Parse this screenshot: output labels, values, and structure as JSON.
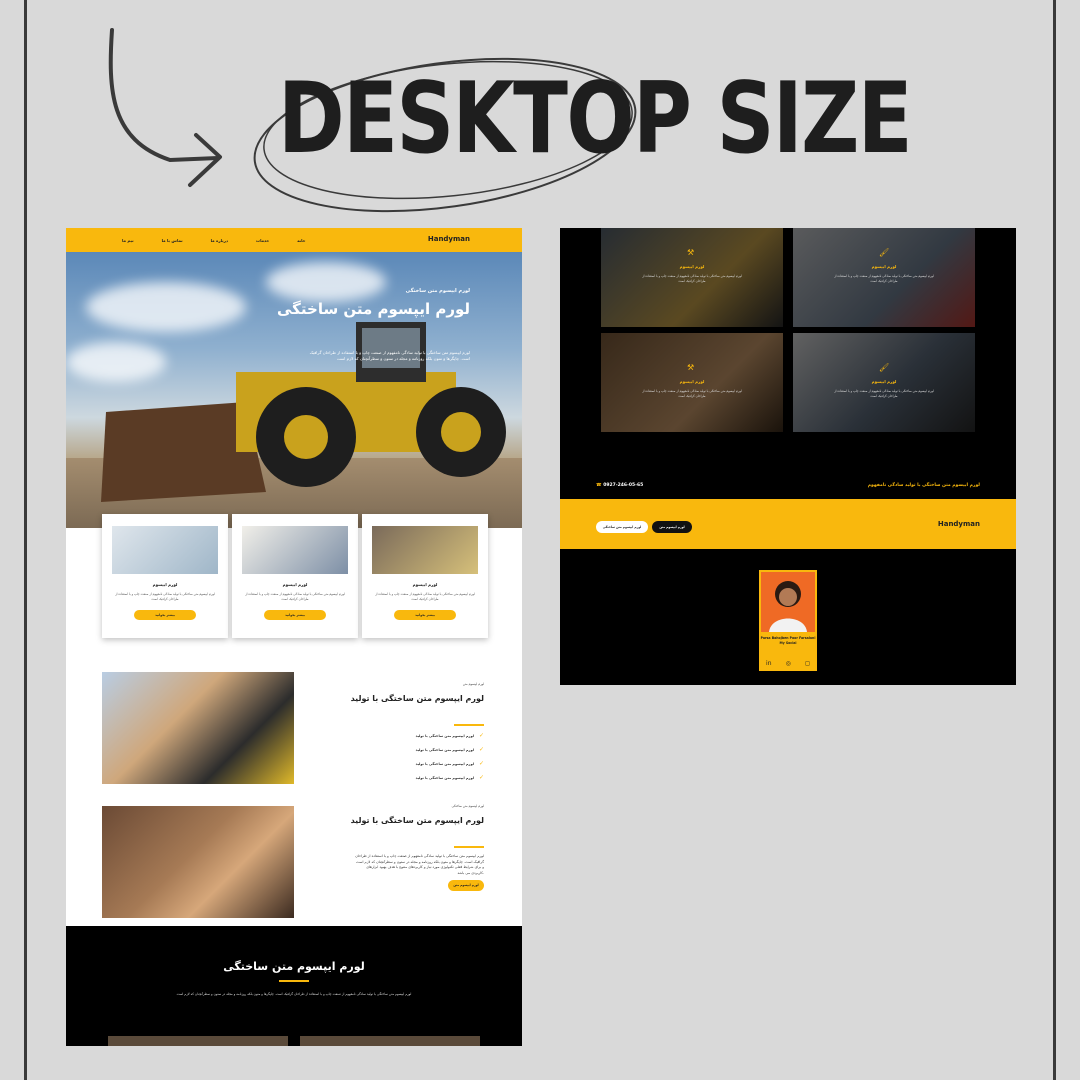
{
  "heading": "DESKTOP SIZE",
  "colors": {
    "accent": "#f9b80d",
    "dark": "#000000",
    "background": "#d9d9d9"
  },
  "left": {
    "logo": "Handyman",
    "nav": [
      "خانه",
      "خدمات",
      "درباره ما",
      "تماس با ما",
      "تیم ما"
    ],
    "hero": {
      "subtitle": "لورم ایپسوم متن ساختگی",
      "title": "لورم ایپسوم متن ساختگی",
      "description": "لورم ایپسوم متن ساختگی با تولید سادگی نامفهوم از صنعت چاپ و با استفاده از طراحان گرافیک است. چاپگرها و متون بلکه روزنامه و مجله در ستون و سطرآنچنان که لازم است"
    },
    "cards": [
      {
        "title": "لورم ایپسوم",
        "desc": "لورم ایپسوم متن ساختگی با تولید سادگی نامفهوم از صنعت چاپ و با استفاده از طراحان گرافیک است",
        "button": "بیشتر بخوانید"
      },
      {
        "title": "لورم ایپسوم",
        "desc": "لورم ایپسوم متن ساختگی با تولید سادگی نامفهوم از صنعت چاپ و با استفاده از طراحان گرافیک است",
        "button": "بیشتر بخوانید"
      },
      {
        "title": "لورم ایپسوم",
        "desc": "لورم ایپسوم متن ساختگی با تولید سادگی نامفهوم از صنعت چاپ و با استفاده از طراحان گرافیک است",
        "button": "بیشتر بخوانید"
      }
    ],
    "section1": {
      "kicker": "لورم ایپسوم متن",
      "title": "لورم ایپسوم متن ساختگی با تولید",
      "checks": [
        "لورم ایپسوم متن ساختگی با تولید",
        "لورم ایپسوم متن ساختگی با تولید",
        "لورم ایپسوم متن ساختگی با تولید",
        "لورم ایپسوم متن ساختگی با تولید"
      ]
    },
    "section2": {
      "kicker": "لورم ایپسوم متن ساختگی",
      "title": "لورم ایپسوم متن ساختگی با تولید",
      "description": "لورم ایپسوم متن ساختگی با تولید سادگی نامفهوم از صنعت چاپ و با استفاده از طراحان گرافیک است. چاپگرها و متون بلکه روزنامه و مجله در ستون و سطرآنچنان که لازم است و برای شرایط فعلی تکنولوژی مورد نیاز و کاربردهای متنوع با هدف بهبود ابزارهای کاربردی می باشد.",
      "button": "لورم ایپسوم متن"
    },
    "black": {
      "title": "لورم ایپسوم متن ساختگی",
      "description": "لورم ایپسوم متن ساختگی با تولید سادگی نامفهوم از صنعت چاپ و با استفاده از طراحان گرافیک است. چاپگرها و متون بلکه روزنامه و مجله در ستون و سطرآنچنان که لازم است"
    }
  },
  "right": {
    "tiles": [
      {
        "title": "لورم ایپسوم",
        "desc": "لورم ایپسوم متن ساختگی با تولید سادگی نامفهوم از صنعت چاپ و با استفاده از طراحان گرافیک است"
      },
      {
        "title": "لورم ایپسوم",
        "desc": "لورم ایپسوم متن ساختگی با تولید سادگی نامفهوم از صنعت چاپ و با استفاده از طراحان گرافیک است"
      },
      {
        "title": "لورم ایپسوم",
        "desc": "لورم ایپسوم متن ساختگی با تولید سادگی نامفهوم از صنعت چاپ و با استفاده از طراحان گرافیک است"
      },
      {
        "title": "لورم ایپسوم",
        "desc": "لورم ایپسوم متن ساختگی با تولید سادگی نامفهوم از صنعت چاپ و با استفاده از طراحان گرافیک است"
      }
    ],
    "phone": "0927-246-05-65",
    "ticker": "لورم ایپسوم متن ساختگی با تولید سادگی نامفهوم",
    "button_dark": "لورم ایپسوم متن",
    "button_light": "لورم ایپسوم متن ساختگی",
    "logo": "Handyman",
    "profile": {
      "name": "Parsa Bahojben Poor Farsalani",
      "role": "My Social"
    }
  }
}
